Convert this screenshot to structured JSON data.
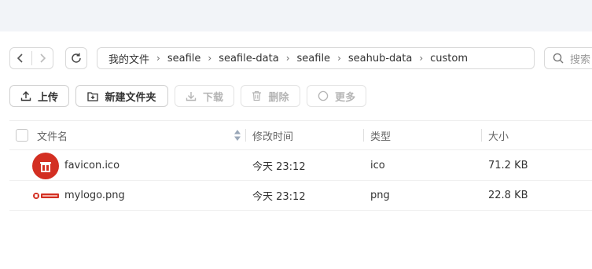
{
  "nav": {
    "back_icon": "chevron-left-icon",
    "forward_icon": "chevron-right-icon",
    "refresh_icon": "refresh-icon"
  },
  "breadcrumb": [
    "我的文件",
    "seafile",
    "seafile-data",
    "seafile",
    "seahub-data",
    "custom"
  ],
  "search": {
    "placeholder": "搜索"
  },
  "toolbar": {
    "upload": "上传",
    "new_folder": "新建文件夹",
    "download": "下载",
    "delete": "删除",
    "more": "更多"
  },
  "table": {
    "headers": {
      "name": "文件名",
      "modified": "修改时间",
      "type": "类型",
      "size": "大小"
    },
    "rows": [
      {
        "name": "favicon.ico",
        "modified": "今天 23:12",
        "type": "ico",
        "size": "71.2 KB",
        "icon": "favicon-thumbnail"
      },
      {
        "name": "mylogo.png",
        "modified": "今天 23:12",
        "type": "png",
        "size": "22.8 KB",
        "icon": "logo-thumbnail"
      }
    ]
  },
  "colors": {
    "accent_red": "#d32f22",
    "border": "#d9d9d9",
    "topbar": "#f2f4f8"
  }
}
